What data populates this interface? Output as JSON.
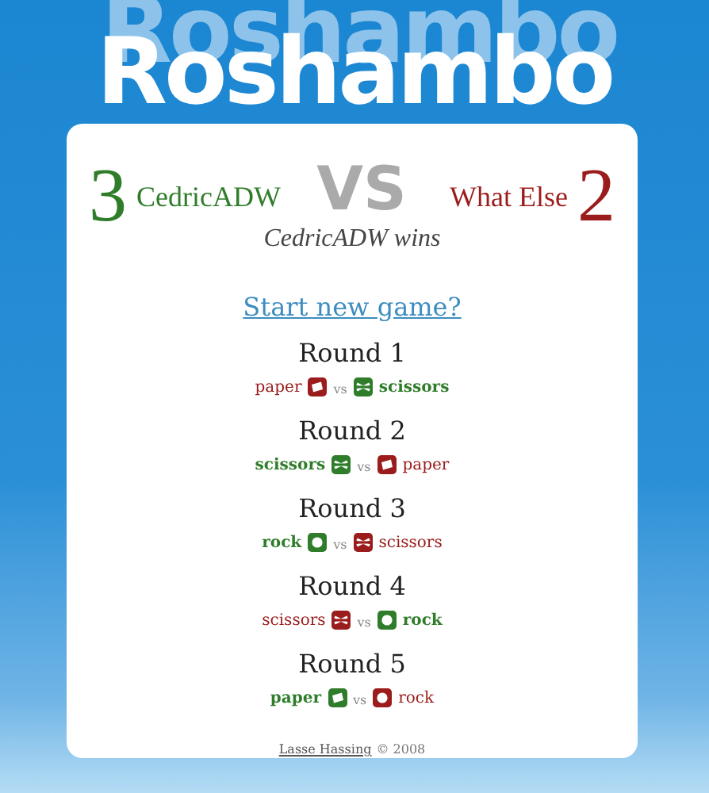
{
  "title": "Roshambo",
  "score": {
    "player_1": {
      "score": "3",
      "name": "CedricADW"
    },
    "vs": "VS",
    "player_2": {
      "name": "What Else",
      "score": "2"
    },
    "result": "CedricADW wins"
  },
  "new_game_link": "Start new game?",
  "rounds": [
    {
      "title": "Round 1",
      "moves": [
        {
          "move": "paper",
          "winner": false
        },
        {
          "move": "scissors",
          "winner": true
        }
      ],
      "separator": "vs"
    },
    {
      "title": "Round 2",
      "moves": [
        {
          "move": "scissors",
          "winner": true
        },
        {
          "move": "paper",
          "winner": false
        }
      ],
      "separator": "vs"
    },
    {
      "title": "Round 3",
      "moves": [
        {
          "move": "rock",
          "winner": true
        },
        {
          "move": "scissors",
          "winner": false
        }
      ],
      "separator": "vs"
    },
    {
      "title": "Round 4",
      "moves": [
        {
          "move": "scissors",
          "winner": false
        },
        {
          "move": "rock",
          "winner": true
        }
      ],
      "separator": "vs"
    },
    {
      "title": "Round 5",
      "moves": [
        {
          "move": "paper",
          "winner": true
        },
        {
          "move": "rock",
          "winner": false
        }
      ],
      "separator": "vs"
    }
  ],
  "footer": {
    "author": "Lasse Hassing",
    "copyright": "© 2008"
  }
}
